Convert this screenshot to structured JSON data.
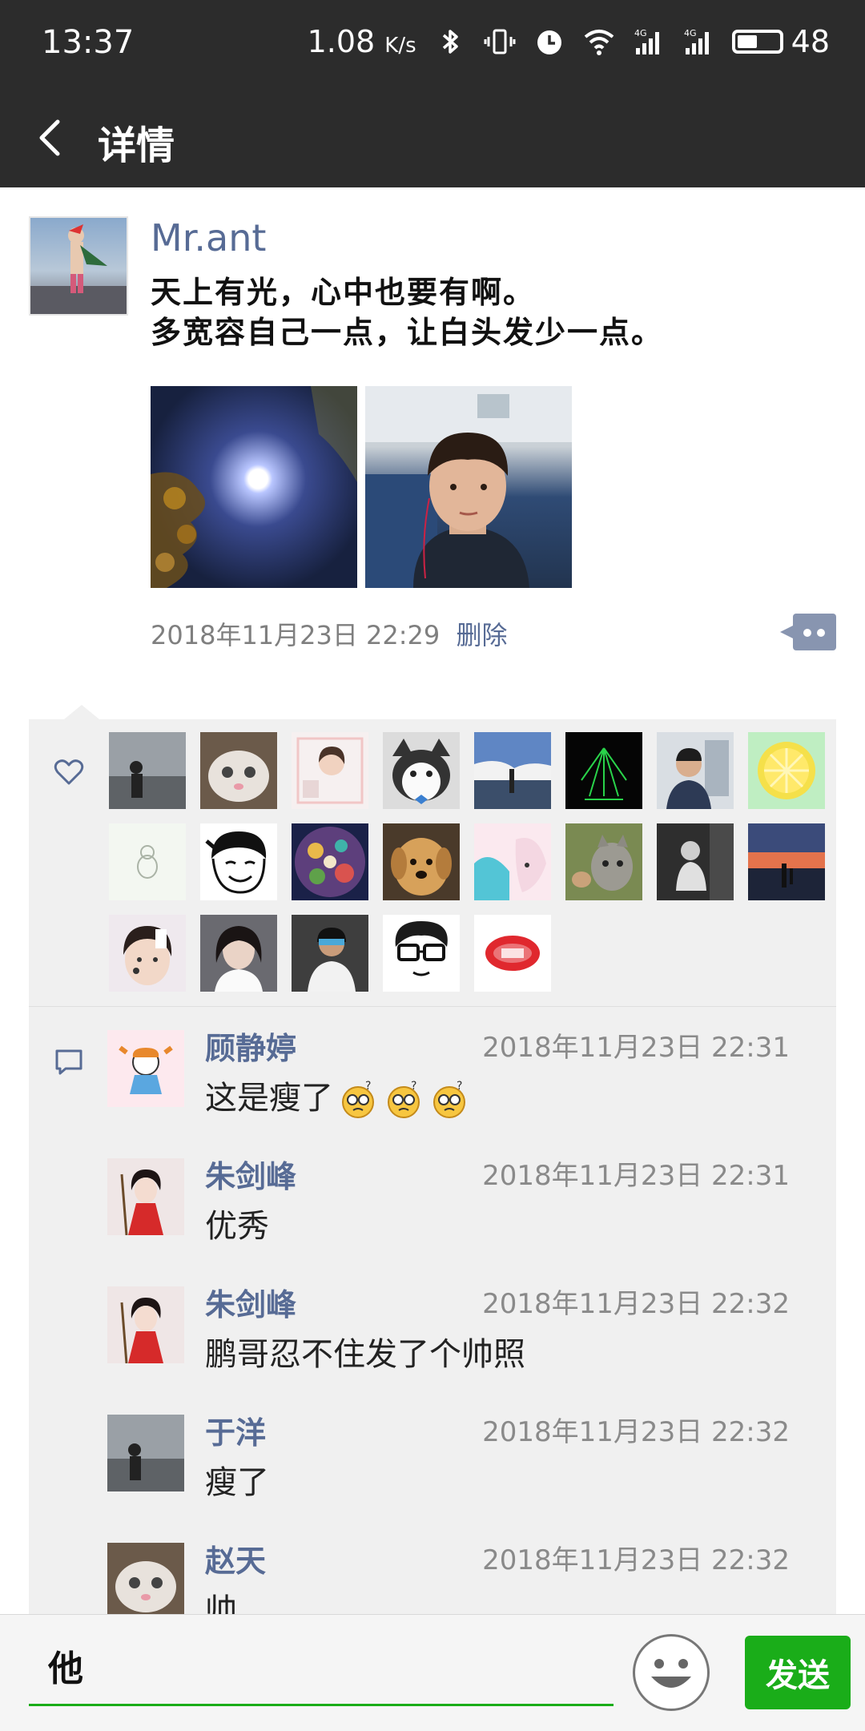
{
  "status_bar": {
    "time": "13:37",
    "network_speed": "1.08",
    "speed_unit": "K/s",
    "signal_label_1": "4G",
    "signal_label_2": "4G",
    "battery": "48"
  },
  "nav": {
    "title": "详情"
  },
  "post": {
    "author": "Mr.ant",
    "text_line1": "天上有光，心中也要有啊。",
    "text_line2": "多宽容自己一点，让白头发少一点。",
    "timestamp": "2018年11月23日 22:29",
    "delete_label": "删除"
  },
  "likes": {
    "count_shown": 21
  },
  "comments": [
    {
      "name": "顾静婷",
      "time": "2018年11月23日 22:31",
      "text": "这是瘦了"
    },
    {
      "name": "朱剑峰",
      "time": "2018年11月23日 22:31",
      "text": "优秀"
    },
    {
      "name": "朱剑峰",
      "time": "2018年11月23日 22:32",
      "text": "鹏哥忍不住发了个帅照"
    },
    {
      "name": "于洋",
      "time": "2018年11月23日 22:32",
      "text": "瘦了"
    },
    {
      "name": "赵天",
      "time": "2018年11月23日 22:32",
      "text": "帅"
    }
  ],
  "input": {
    "value": "他",
    "send_label": "发送"
  },
  "colors": {
    "header_bg": "#2c2c2c",
    "link_blue": "#576b95",
    "send_green": "#1aad19",
    "feedback_bg": "#f0f0f0"
  }
}
